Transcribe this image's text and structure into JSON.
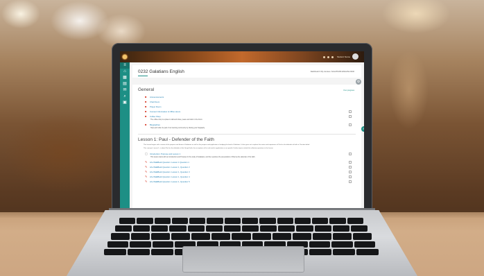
{
  "navbar": {
    "user_name": "Student Name"
  },
  "sidebar": {
    "icons": [
      "menu-icon",
      "home-icon",
      "calendar-icon",
      "files-icon",
      "mail-icon",
      "search-icon",
      "dashboard-icon"
    ]
  },
  "header": {
    "title": "0232 Galatians English",
    "breadcrumb": "Dashboard / My courses / GALATIANS ENGLISH 0232"
  },
  "general": {
    "title": "General",
    "hint": "Your progress",
    "activities": [
      {
        "label": "Announcements",
        "icon": "forum-icon"
      },
      {
        "label": "Chat Room",
        "icon": "chat-icon"
      },
      {
        "label": "Prayer Room",
        "icon": "forum-icon"
      },
      {
        "label": "Connect Information & Office Hours",
        "icon": "forum-icon"
      },
      {
        "label": "Coffee Shop",
        "icon": "forum-icon"
      },
      {
        "label": "Biographies",
        "icon": "forum-icon"
      }
    ],
    "notes": [
      "The coffee shop is a place to talk and share, peace and calm in the forum.",
      "Help each other be part of our learning community by sharing your biography."
    ]
  },
  "lesson1": {
    "title": "Lesson 1: Paul - Defender of the Faith",
    "desc1": "This lesson begins with a review of the purpose and theme of Galatians as well as the purpose and application of studying the book of Galatians. It then goes on to explore the nature and importance of Paul as the defender of faith in Christian belief.",
    "desc2": "This concept, Lesson 1, is about Paul as the defender of the Gospel faith, the acceptance of his role and its application as an apostle. Further topics include the reflection questions in the lesson.",
    "activities": [
      {
        "label": "Introduction: Purpose and Lesson 1",
        "icon": "page-icon"
      },
      {
        "label": "Life WalkBack Question: Lesson 1 Question 1",
        "icon": "quiz-icon"
      },
      {
        "label": "Life WalkBack Question: Lesson 1, Question 2",
        "icon": "quiz-icon"
      },
      {
        "label": "Life WalkBack Question: Lesson 1, Question 3",
        "icon": "quiz-icon"
      },
      {
        "label": "Life WalkBack Question: Lesson 1, Question 4",
        "icon": "quiz-icon"
      },
      {
        "label": "Life WalkBack Question: Lesson 1, Question 5",
        "icon": "quiz-icon"
      }
    ],
    "note": "This lesson starts with an introduction and Purpose for the study of Galatians, and then explores the presentation of Paul as the defender of the faith."
  },
  "colors": {
    "accent": "#1d8f85",
    "link": "#1d7fb3",
    "forum_icon": "#d9412f"
  }
}
